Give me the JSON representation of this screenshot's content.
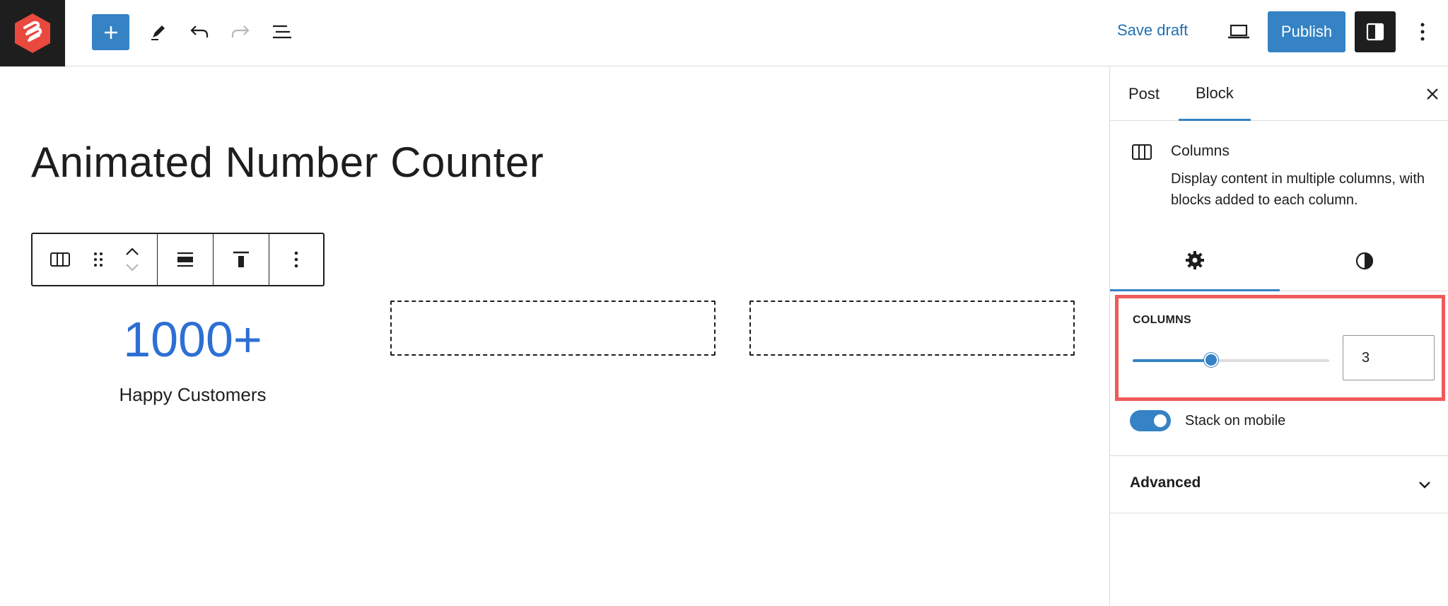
{
  "colors": {
    "accent": "#3582c4",
    "dark": "#1e1e1e",
    "counter_blue": "#2d6fd4",
    "highlight_red": "#f05a5a",
    "logo_red": "#e9493e"
  },
  "topbar": {
    "logo_icon": "site-logo-icon",
    "add_block_icon": "plus-icon",
    "tools_icon": "pencil-icon",
    "undo_icon": "undo-icon",
    "redo_icon": "redo-icon",
    "list_view_icon": "list-view-icon",
    "save_draft_label": "Save draft",
    "preview_icon": "laptop-icon",
    "publish_label": "Publish",
    "settings_icon": "sidebar-toggle-icon",
    "options_icon": "vertical-dots-icon"
  },
  "editor": {
    "post_title": "Animated Number Counter",
    "block_toolbar": {
      "items": [
        "columns-icon",
        "drag-handle-icon",
        "move-up-icon",
        "move-down-icon",
        "align-wide-icon",
        "align-top-icon",
        "more-options-icon"
      ]
    },
    "columns": [
      {
        "number": "1000+",
        "label": "Happy Customers"
      },
      {
        "number": "",
        "label": ""
      },
      {
        "number": "",
        "label": ""
      }
    ]
  },
  "sidebar": {
    "tabs": [
      {
        "label": "Post",
        "active": false
      },
      {
        "label": "Block",
        "active": true
      }
    ],
    "close_icon": "close-icon",
    "block_card": {
      "icon": "columns-icon",
      "title": "Columns",
      "description": "Display content in multiple columns, with blocks added to each column."
    },
    "sub_tabs": [
      {
        "icon": "gear-icon",
        "active": true
      },
      {
        "icon": "contrast-icon",
        "active": false
      }
    ],
    "columns_control": {
      "label": "Columns",
      "value": "3",
      "slider_fraction": 0.4
    },
    "stack_on_mobile": {
      "label": "Stack on mobile",
      "checked": true
    },
    "advanced": {
      "label": "Advanced",
      "icon": "chevron-down-icon"
    }
  }
}
